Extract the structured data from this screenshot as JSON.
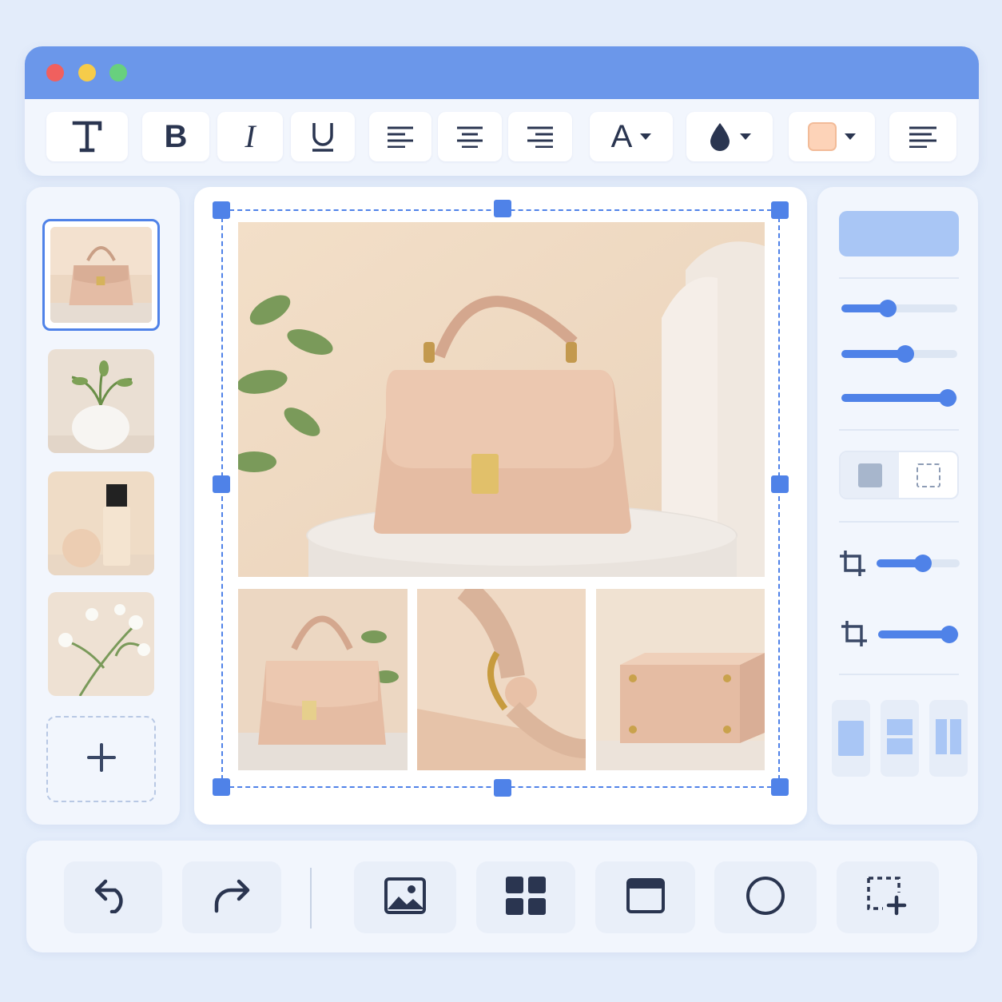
{
  "window": {
    "traffic_lights": {
      "close": "#f0605e",
      "minimize": "#f6cc4a",
      "maximize": "#68d07e"
    },
    "title_bar_color": "#6b97ea"
  },
  "toolbar": {
    "items": [
      {
        "id": "text",
        "icon": "text-icon",
        "glyph": "T"
      },
      {
        "id": "bold",
        "icon": "bold-icon",
        "glyph": "B"
      },
      {
        "id": "italic",
        "icon": "italic-icon",
        "glyph": "I"
      },
      {
        "id": "underline",
        "icon": "underline-icon",
        "glyph": "U"
      },
      {
        "id": "align-left",
        "icon": "align-left-icon"
      },
      {
        "id": "align-center",
        "icon": "align-center-icon"
      },
      {
        "id": "align-right",
        "icon": "align-right-icon"
      },
      {
        "id": "font-color",
        "icon": "font-color-icon",
        "glyph": "A",
        "has_dropdown": true
      },
      {
        "id": "fill-color",
        "icon": "droplet-icon",
        "has_dropdown": true
      },
      {
        "id": "swatch",
        "icon": "color-swatch-icon",
        "color": "#fdd3b8",
        "has_dropdown": true
      },
      {
        "id": "paragraph",
        "icon": "paragraph-icon"
      }
    ]
  },
  "thumbnails": [
    {
      "id": "handbag",
      "icon": "handbag-thumbnail",
      "selected": true
    },
    {
      "id": "plant-vase",
      "icon": "plant-vase-thumbnail",
      "selected": false
    },
    {
      "id": "cosmetic-bottle",
      "icon": "cosmetic-bottle-thumbnail",
      "selected": false
    },
    {
      "id": "white-flowers",
      "icon": "white-flowers-thumbnail",
      "selected": false
    }
  ],
  "add_thumbnail_icon": "plus-icon",
  "canvas": {
    "selection_color": "#4f82e8",
    "photos": [
      "handbag-main-photo",
      "handbag-side-photo",
      "strap-closeup-photo",
      "bag-bottom-photo"
    ]
  },
  "properties": {
    "accent": "#4f82e8",
    "sliders": [
      {
        "id": "slider-1",
        "value": 0.4
      },
      {
        "id": "slider-2",
        "value": 0.55
      },
      {
        "id": "slider-3",
        "value": 0.92
      }
    ],
    "fill_toggle": {
      "options": [
        "solid-fill-icon",
        "no-fill-icon"
      ],
      "selected": 0
    },
    "crop_sliders": [
      {
        "id": "crop-1",
        "icon": "crop-icon",
        "value": 0.56
      },
      {
        "id": "crop-2",
        "icon": "crop-icon",
        "value": 0.88
      }
    ],
    "layouts": [
      "layout-single-icon",
      "layout-rows-icon",
      "layout-columns-icon"
    ]
  },
  "bottom_toolbar": {
    "items": [
      "undo-icon",
      "redo-icon",
      "image-icon",
      "grid-icon",
      "window-frame-icon",
      "circle-icon",
      "add-selection-icon"
    ]
  }
}
